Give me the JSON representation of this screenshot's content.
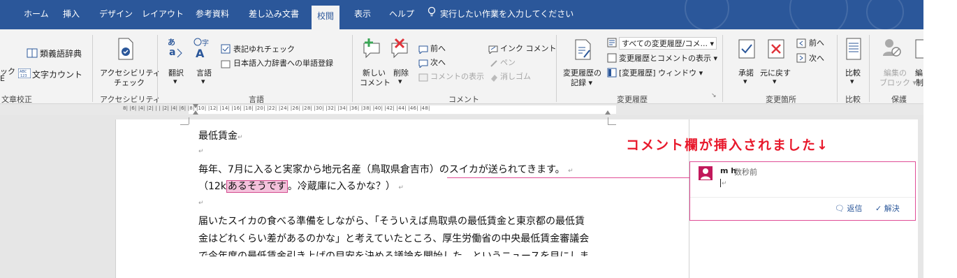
{
  "tabs": [
    "ホーム",
    "挿入",
    "デザイン",
    "レイアウト",
    "参考資料",
    "差し込み文書",
    "校閲",
    "表示",
    "ヘルプ"
  ],
  "tell_me": "実行したい作業を入力してください",
  "ribbon": {
    "proofing": {
      "thesaurus": "類義語辞典",
      "wordcount": "文字カウント",
      "cut_left_top": "ック",
      "cut_left_bottom": "E",
      "group": "文章校正"
    },
    "accessibility": {
      "btn_line1": "アクセシビリティ",
      "btn_line2": "チェック",
      "group": "アクセシビリティ"
    },
    "language": {
      "translate": "翻訳",
      "language": "言語",
      "spelling_variants": "表記ゆれチェック",
      "ime_register": "日本語入力辞書への単語登録",
      "group": "言語"
    },
    "comments": {
      "new_line1": "新しい",
      "new_line2": "コメント",
      "delete": "削除",
      "prev": "前へ",
      "next": "次へ",
      "show_comments": "コメントの表示",
      "ink_comment": "インク コメント",
      "pen": "ペン",
      "eraser": "消しゴム",
      "group": "コメント"
    },
    "tracking": {
      "track_line1": "変更履歴の",
      "track_line2": "記録",
      "all_markup": "すべての変更履歴/コメ...",
      "show_markup": "変更履歴とコメントの表示",
      "reviewing_pane": "[変更履歴] ウィンドウ",
      "group": "変更履歴"
    },
    "changes": {
      "accept": "承諾",
      "reject": "元に戻す",
      "prev": "前へ",
      "next": "次へ",
      "group": "変更箇所"
    },
    "compare": {
      "compare": "比較",
      "group": "比較"
    },
    "protect": {
      "block_line1": "編集の",
      "block_line2": "ブロック",
      "restrict": "編",
      "restrict2": "制",
      "group": "保護"
    }
  },
  "ruler_text": "8|  |6|  |4|  |2|  |  |  |2|  |4|  |6|  |8|  |10|  |12|  |14|  |16|  |18|  |20|  |22|  |24|  |26|  |28|  |30|  |32|  |34|  |36|  |38|  |40|  |42|  |44|  |46|  |48|",
  "document": {
    "title": "最低賃金",
    "para1_line1": "毎年、7月に入ると実家から地元名産（鳥取県倉吉市）のスイカが送られてきます。",
    "para1_line2_before": "（12k",
    "para1_highlight": "あるそうです",
    "para1_line2_after": "。冷蔵庫に入るかな？）",
    "para2_line1": "届いたスイカの食べる準備をしながら、「そういえば鳥取県の最低賃金と東京都の最低賃",
    "para2_line2": "金はどれくらい差があるのかな」と考えていたところ、厚生労働省の中央最低賃金審議会",
    "para2_line3": "で今年度の最低賃金引き上げの目安を決める議論を開始した、というニュースを目にしま"
  },
  "annotation": "コメント欄が挿入されました↓",
  "comment": {
    "author": "m h",
    "time": "数秒前",
    "reply": "返信",
    "resolve": "解決"
  },
  "colors": {
    "ribbon_blue": "#2b579a",
    "comment_pink": "#e04d96",
    "avatar": "#c2185b",
    "annotation_red": "#e8192c"
  }
}
